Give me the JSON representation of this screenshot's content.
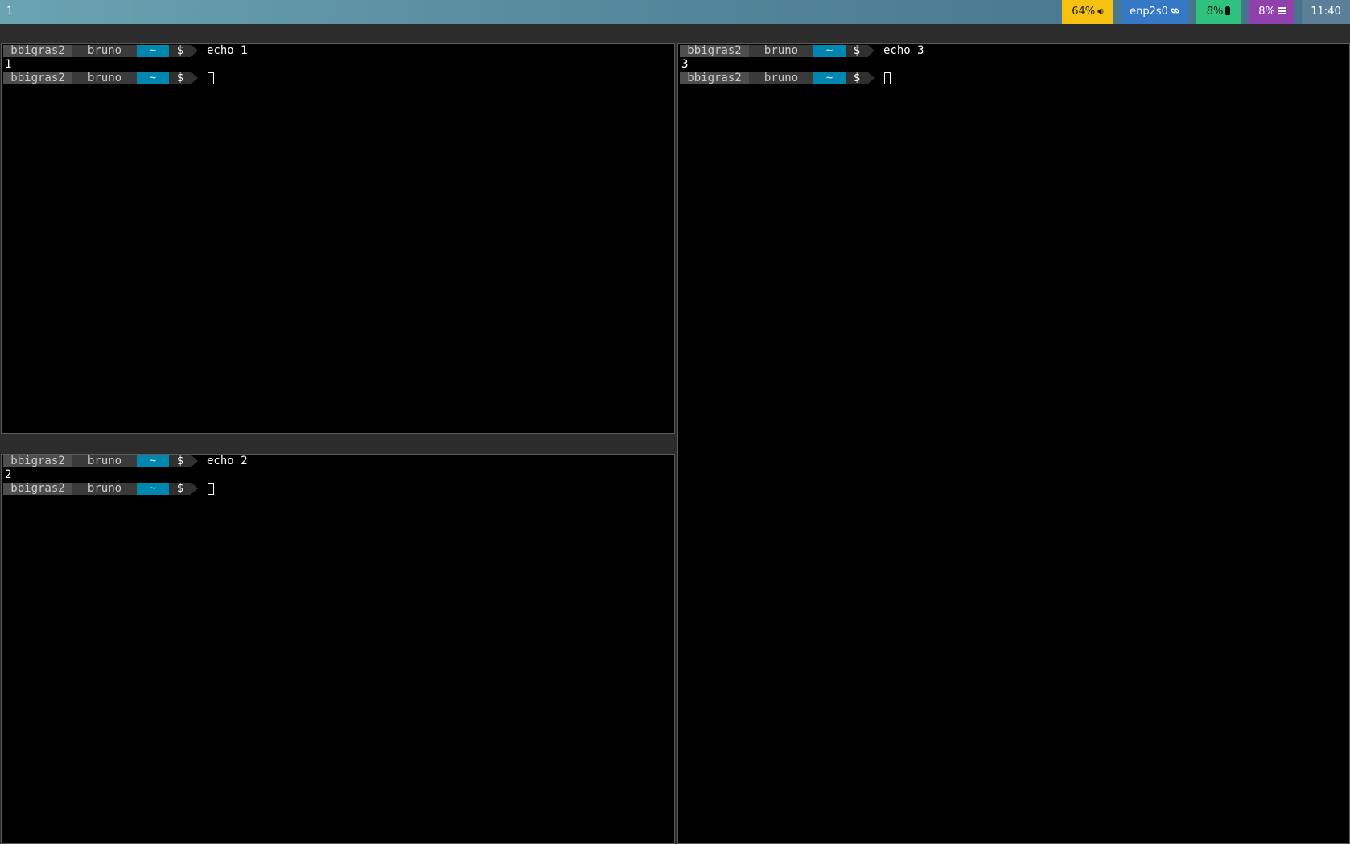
{
  "topbar": {
    "workspace": "1",
    "volume": "64%",
    "network": "enp2s0",
    "cpu": "8%",
    "memory": "8%",
    "clock": "11:40",
    "colors": {
      "volume": "#f5c211",
      "network": "#3478c6",
      "cpu": "#2ec27e",
      "memory": "#9141ac",
      "clock": "#5b7f96"
    },
    "icons": {
      "volume": "speaker-icon",
      "network": "link-icon",
      "cpu": "cpu-icon",
      "memory": "menu-icon"
    }
  },
  "prompt": {
    "host": "bbigras2",
    "user": "bruno",
    "dir": "~",
    "symbol": "$"
  },
  "panes": [
    {
      "command": "echo 1",
      "output": "1"
    },
    {
      "command": "echo 2",
      "output": "2"
    },
    {
      "command": "echo 3",
      "output": "3"
    }
  ]
}
